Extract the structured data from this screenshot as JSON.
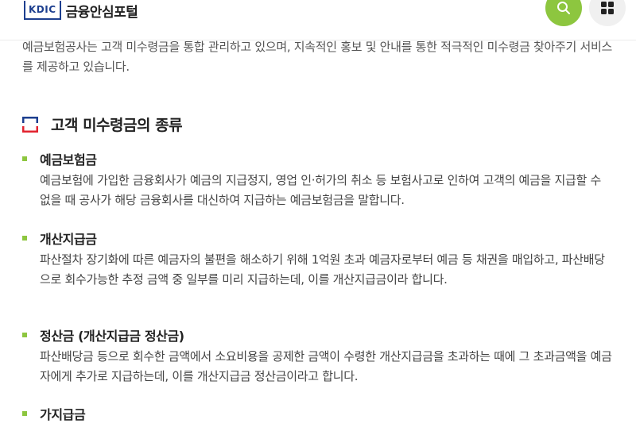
{
  "header": {
    "logo_mark": "KDIC",
    "logo_text": "금융안심포털",
    "search_icon": "search-icon",
    "menu_icon": "grid-menu-icon",
    "accent": "#8dc63f"
  },
  "intro": {
    "text": "예금보험공사는 고객 미수령금을 통합 관리하고 있으며, 지속적인 홍보 및 안내를 통한 적극적인 미수령금 찾아주기 서비스를 제공하고 있습니다."
  },
  "section": {
    "title": "고객 미수령금의 종류",
    "items": [
      {
        "title": "예금보험금",
        "desc": "예금보험에 가입한 금융회사가 예금의 지급정지, 영업 인·허가의 취소 등 보험사고로 인하여 고객의 예금을 지급할 수 없을 때 공사가 해당 금융회사를 대신하여 지급하는 예금보험금을 말합니다."
      },
      {
        "title": "개산지급금",
        "desc": "파산절차 장기화에 따른 예금자의 불편을 해소하기 위해 1억원 초과 예금자로부터 예금 등 채권을 매입하고, 파산배당으로 회수가능한 추정 금액 중 일부를 미리 지급하는데, 이를 개산지급금이라 합니다."
      },
      {
        "title": "정산금 (개산지급금 정산금)",
        "desc": "파산배당금 등으로 회수한 금액에서 소요비용을 공제한 금액이 수령한 개산지급금을 초과하는 때에 그 초과금액을 예금자에게 추가로 지급하는데, 이를 개산지급금 정산금이라고 합니다."
      },
      {
        "title": "가지급금",
        "desc": ""
      }
    ]
  }
}
